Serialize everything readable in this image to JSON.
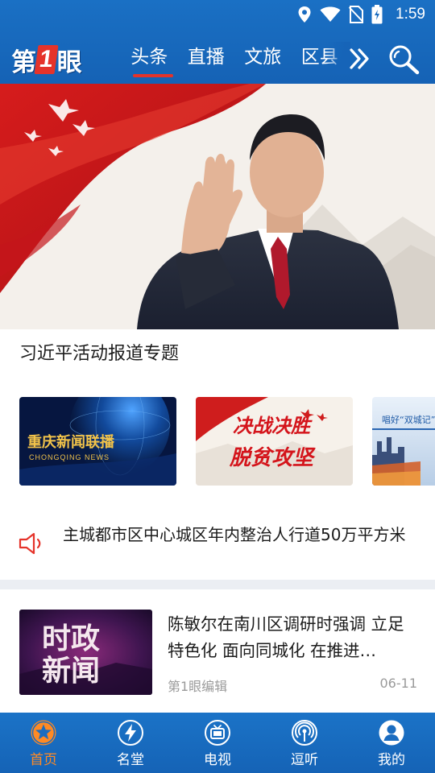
{
  "status_bar": {
    "time": "1:59"
  },
  "header": {
    "logo": {
      "prefix": "第",
      "number": "1",
      "suffix": "眼"
    },
    "tabs": [
      {
        "label": "头条",
        "active": true
      },
      {
        "label": "直播",
        "active": false
      },
      {
        "label": "文旅",
        "active": false
      },
      {
        "label": "区县",
        "active": false
      }
    ],
    "icons": {
      "more": "double-chevron-right-icon",
      "search": "search-icon"
    }
  },
  "banner": {
    "caption": "习近平活动报道专题"
  },
  "program_cards": [
    {
      "title": "重庆新闻联播",
      "subtitle": "CHONGQING NEWS"
    },
    {
      "line1": "决战决胜",
      "line2": "脱贫攻坚"
    },
    {
      "title": "唱好“双城记”"
    }
  ],
  "notice": {
    "icon": "speaker-icon",
    "text": "主城都市区中心城区年内整治人行道50万平方米"
  },
  "news": [
    {
      "thumb_text_1": "时政",
      "thumb_text_2": "新闻",
      "title": "陈敏尔在南川区调研时强调 立足特色化 面向同城化 在推进…",
      "source": "第1眼编辑",
      "date": "06-11"
    }
  ],
  "bottom_nav": [
    {
      "label": "首页",
      "icon": "star-icon",
      "active": true
    },
    {
      "label": "名堂",
      "icon": "lightning-icon",
      "active": false
    },
    {
      "label": "电视",
      "icon": "tv-icon",
      "active": false
    },
    {
      "label": "逗听",
      "icon": "broadcast-icon",
      "active": false
    },
    {
      "label": "我的",
      "icon": "user-icon",
      "active": false
    }
  ],
  "colors": {
    "brand_blue": "#1a6cc0",
    "accent_red": "#e5332a",
    "nav_active": "#ff8a24"
  }
}
